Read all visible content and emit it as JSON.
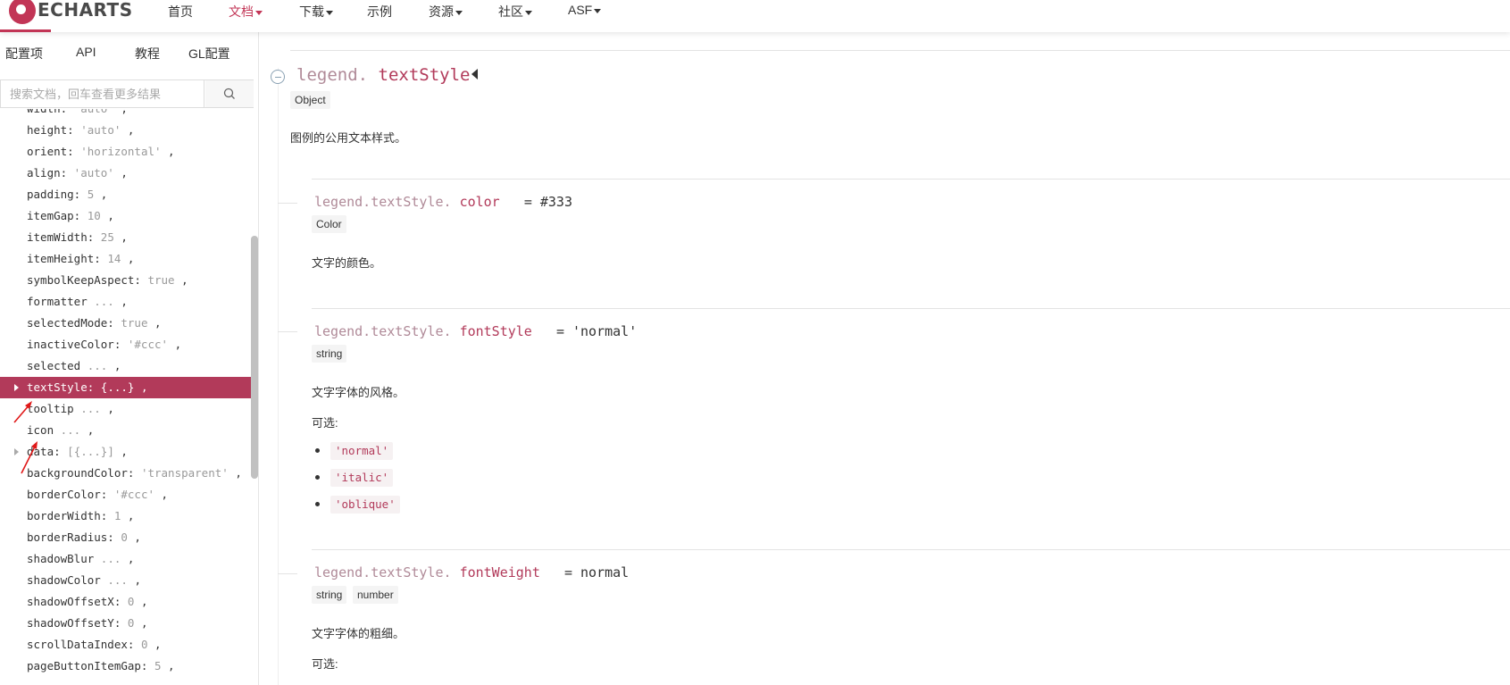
{
  "nav": {
    "logo_text": "ECHARTS",
    "items": [
      {
        "label": "首页",
        "dropdown": false,
        "active": false
      },
      {
        "label": "文档",
        "dropdown": true,
        "active": true
      },
      {
        "label": "下载",
        "dropdown": true,
        "active": false
      },
      {
        "label": "示例",
        "dropdown": false,
        "active": false
      },
      {
        "label": "资源",
        "dropdown": true,
        "active": false
      },
      {
        "label": "社区",
        "dropdown": true,
        "active": false
      },
      {
        "label": "ASF",
        "dropdown": true,
        "active": false
      }
    ],
    "accent_color": "#c23556"
  },
  "sidebar": {
    "tabs": [
      "配置项",
      "API",
      "教程",
      "GL配置"
    ],
    "search": {
      "placeholder": "搜索文档，回车查看更多结果"
    },
    "tree": [
      {
        "key": "width:",
        "value": " 'auto' ",
        "suffix": ","
      },
      {
        "key": "height:",
        "value": " 'auto' ",
        "suffix": ","
      },
      {
        "key": "orient:",
        "value": " 'horizontal' ",
        "suffix": ","
      },
      {
        "key": "align:",
        "value": " 'auto' ",
        "suffix": ","
      },
      {
        "key": "padding:",
        "value": " 5 ",
        "suffix": ","
      },
      {
        "key": "itemGap:",
        "value": " 10 ",
        "suffix": ","
      },
      {
        "key": "itemWidth:",
        "value": " 25 ",
        "suffix": ","
      },
      {
        "key": "itemHeight:",
        "value": " 14 ",
        "suffix": ","
      },
      {
        "key": "symbolKeepAspect:",
        "value": " true ",
        "suffix": ","
      },
      {
        "key": "formatter",
        "value": " ... ",
        "suffix": ","
      },
      {
        "key": "selectedMode:",
        "value": " true ",
        "suffix": ","
      },
      {
        "key": "inactiveColor:",
        "value": " '#ccc' ",
        "suffix": ","
      },
      {
        "key": "selected",
        "value": " ... ",
        "suffix": ","
      },
      {
        "key": "textStyle:",
        "value": " {...} ",
        "suffix": ",",
        "selected": true,
        "expandable": true
      },
      {
        "key": "tooltip",
        "value": " ... ",
        "suffix": ","
      },
      {
        "key": "icon",
        "value": " ... ",
        "suffix": ","
      },
      {
        "key": "data:",
        "value": " [{...}] ",
        "suffix": ",",
        "expandable": true
      },
      {
        "key": "backgroundColor:",
        "value": " 'transparent' ",
        "suffix": ","
      },
      {
        "key": "borderColor:",
        "value": " '#ccc' ",
        "suffix": ","
      },
      {
        "key": "borderWidth:",
        "value": " 1 ",
        "suffix": ","
      },
      {
        "key": "borderRadius:",
        "value": " 0 ",
        "suffix": ","
      },
      {
        "key": "shadowBlur",
        "value": " ... ",
        "suffix": ","
      },
      {
        "key": "shadowColor",
        "value": " ... ",
        "suffix": ","
      },
      {
        "key": "shadowOffsetX:",
        "value": " 0 ",
        "suffix": ","
      },
      {
        "key": "shadowOffsetY:",
        "value": " 0 ",
        "suffix": ","
      },
      {
        "key": "scrollDataIndex:",
        "value": " 0 ",
        "suffix": ","
      },
      {
        "key": "pageButtonItemGap:",
        "value": " 5 ",
        "suffix": ","
      }
    ],
    "selected_color": "#b23a5a"
  },
  "main": {
    "section": {
      "prefix": "legend.",
      "name": "textStyle",
      "type": "Object",
      "desc": "图例的公用文本样式。"
    },
    "props": [
      {
        "prefix": "legend.textStyle.",
        "name": "color",
        "default": "= #333",
        "types": [
          "Color"
        ],
        "desc": "文字的颜色。"
      },
      {
        "prefix": "legend.textStyle.",
        "name": "fontStyle",
        "default": "= 'normal'",
        "types": [
          "string"
        ],
        "desc": "文字字体的风格。",
        "options_label": "可选:",
        "options": [
          "'normal'",
          "'italic'",
          "'oblique'"
        ]
      },
      {
        "prefix": "legend.textStyle.",
        "name": "fontWeight",
        "default": "= normal",
        "types": [
          "string",
          "number"
        ],
        "desc": "文字字体的粗细。",
        "options_label": "可选:"
      }
    ]
  }
}
